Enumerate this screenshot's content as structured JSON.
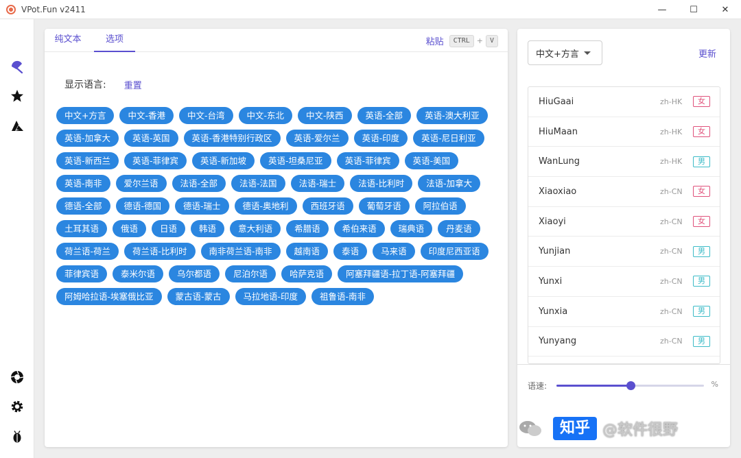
{
  "window": {
    "title": "VPot.Fun v2411",
    "minimize": "—",
    "maximize": "☐",
    "close": "✕"
  },
  "tabs": [
    {
      "label": "纯文本"
    },
    {
      "label": "选项"
    }
  ],
  "paste": {
    "label": "粘贴",
    "key1": "CTRL",
    "plus": "+",
    "key2": "V"
  },
  "options": {
    "lang_label": "显示语言:",
    "reset": "重置",
    "languages": [
      "中文+方言",
      "中文-香港",
      "中文-台湾",
      "中文-东北",
      "中文-陕西",
      "英语-全部",
      "英语-澳大利亚",
      "英语-加拿大",
      "英语-英国",
      "英语-香港特别行政区",
      "英语-爱尔兰",
      "英语-印度",
      "英语-尼日利亚",
      "英语-新西兰",
      "英语-菲律宾",
      "英语-新加坡",
      "英语-坦桑尼亚",
      "英语-菲律宾",
      "英语-美国",
      "英语-南非",
      "爱尔兰语",
      "法语-全部",
      "法语-法国",
      "法语-瑞士",
      "法语-比利时",
      "法语-加拿大",
      "德语-全部",
      "德语-德国",
      "德语-瑞士",
      "德语-奥地利",
      "西班牙语",
      "葡萄牙语",
      "阿拉伯语",
      "土耳其语",
      "俄语",
      "日语",
      "韩语",
      "意大利语",
      "希腊语",
      "希伯来语",
      "瑞典语",
      "丹麦语",
      "荷兰语-荷兰",
      "荷兰语-比利时",
      "南非荷兰语-南非",
      "越南语",
      "泰语",
      "马来语",
      "印度尼西亚语",
      "菲律宾语",
      "泰米尔语",
      "乌尔都语",
      "尼泊尔语",
      "哈萨克语",
      "阿塞拜疆语-拉丁语-阿塞拜疆",
      "阿姆哈拉语-埃塞俄比亚",
      "蒙古语-蒙古",
      "马拉地语-印度",
      "祖鲁语-南非"
    ]
  },
  "right": {
    "dialect": "中文+方言",
    "refresh": "更新",
    "voices": [
      {
        "name": "HiuGaai",
        "locale": "zh-HK",
        "gender": "女",
        "g": "f"
      },
      {
        "name": "HiuMaan",
        "locale": "zh-HK",
        "gender": "女",
        "g": "f"
      },
      {
        "name": "WanLung",
        "locale": "zh-HK",
        "gender": "男",
        "g": "m"
      },
      {
        "name": "Xiaoxiao",
        "locale": "zh-CN",
        "gender": "女",
        "g": "f"
      },
      {
        "name": "Xiaoyi",
        "locale": "zh-CN",
        "gender": "女",
        "g": "f"
      },
      {
        "name": "Yunjian",
        "locale": "zh-CN",
        "gender": "男",
        "g": "m"
      },
      {
        "name": "Yunxi",
        "locale": "zh-CN",
        "gender": "男",
        "g": "m"
      },
      {
        "name": "Yunxia",
        "locale": "zh-CN",
        "gender": "男",
        "g": "m"
      },
      {
        "name": "Yunyang",
        "locale": "zh-CN",
        "gender": "男",
        "g": "m"
      }
    ],
    "speed_label": "语速:",
    "speed_unit": "%",
    "speed_fraction": 0.5
  },
  "watermark": {
    "zhihu": "知乎",
    "text": "@软件很野"
  },
  "colors": {
    "accent": "#5a4fcf",
    "chip": "#2b86e0",
    "female": "#e0507a",
    "male": "#3bbbc7"
  }
}
